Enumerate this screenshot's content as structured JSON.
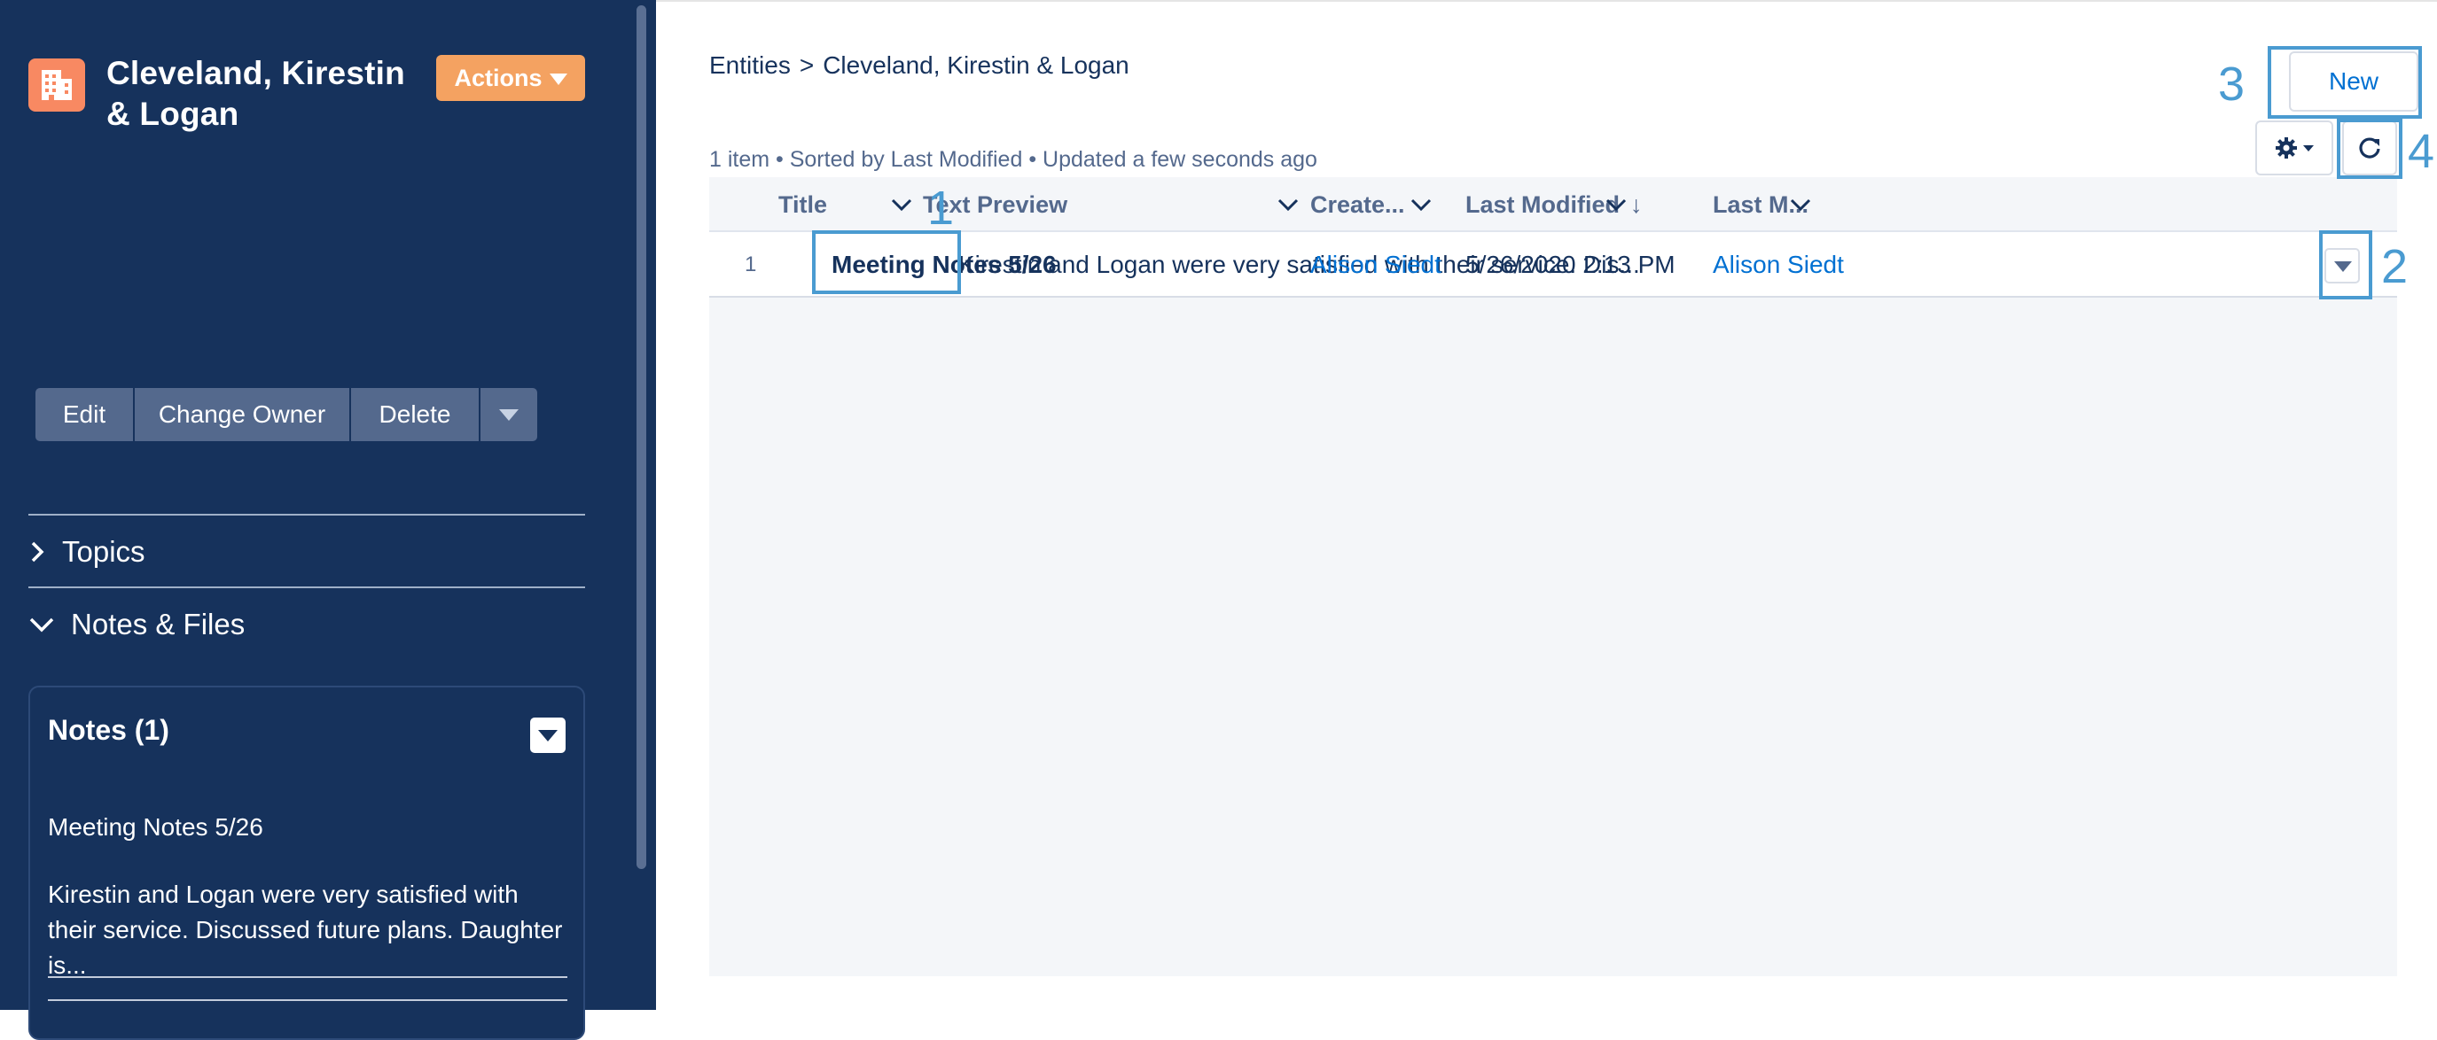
{
  "record": {
    "title": "Cleveland, Kirestin & Logan",
    "actions_label": "Actions",
    "buttons": [
      "Edit",
      "Change Owner",
      "Delete"
    ]
  },
  "sections": {
    "topics": "Topics",
    "notes_files": "Notes & Files"
  },
  "notes_card": {
    "heading": "Notes (1)",
    "note_title": "Meeting Notes 5/26",
    "note_preview": "Kirestin and Logan were very satisfied with their service. Discussed future plans. Daughter is..."
  },
  "breadcrumb": {
    "root": "Entities",
    "separator": ">",
    "current": "Cleveland, Kirestin & Logan"
  },
  "list": {
    "status": "1 item • Sorted by Last Modified • Updated a few seconds ago",
    "new_label": "New",
    "columns": [
      "Title",
      "Text Preview",
      "Create...",
      "Last Modified",
      "Last M..."
    ],
    "sort_arrow": "↓",
    "rows": [
      {
        "num": "1",
        "title": "Meeting Notes 5/26",
        "preview": "Kirestin and Logan were very satisfied with their service. Dis...",
        "created_by": "Alison Siedt",
        "last_modified": "5/26/2020 2:13 PM",
        "last_modified_by": "Alison Siedt"
      }
    ]
  },
  "annotations": [
    "1",
    "2",
    "3",
    "4"
  ],
  "colors": {
    "sidebar_bg": "#16325c",
    "accent_orange": "#f4a261",
    "link_blue": "#0070d2",
    "annotation_blue": "#4a9bd1"
  }
}
